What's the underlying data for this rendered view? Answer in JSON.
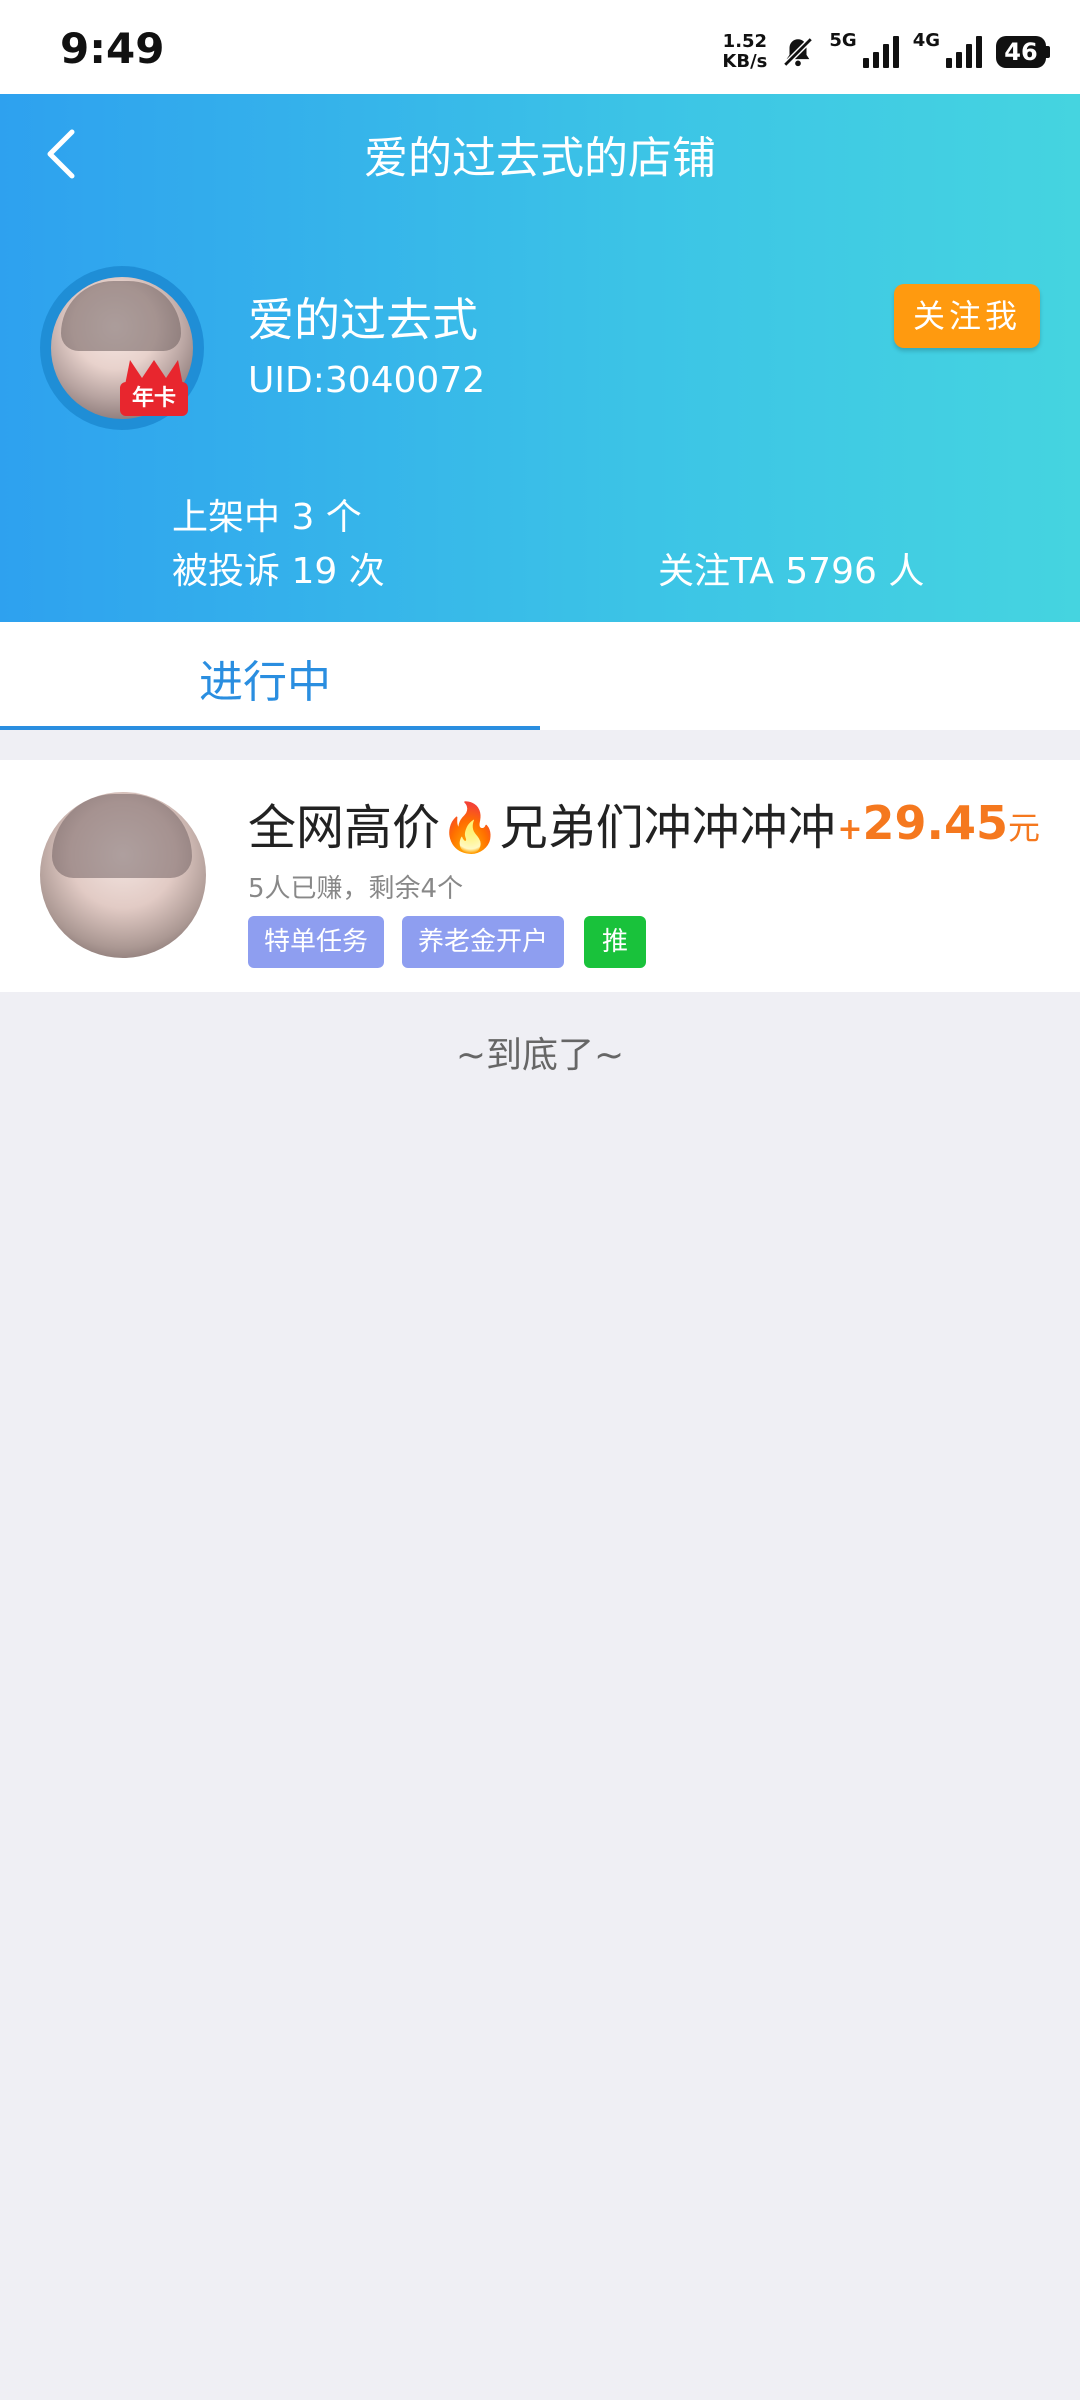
{
  "status_bar": {
    "time": "9:49",
    "net_speed_value": "1.52",
    "net_speed_unit": "KB/s",
    "signal_1": "5G",
    "signal_2": "4G",
    "battery": "46"
  },
  "header": {
    "title": "爱的过去式的店铺",
    "shop_name": "爱的过去式",
    "uid": "UID:3040072",
    "vip_badge": "年卡",
    "follow_label": "关注我",
    "stat_listed": "上架中 3 个",
    "stat_complaints": "被投诉 19 次",
    "stat_followers": "关注TA 5796 人"
  },
  "tabs": [
    {
      "label": "进行中",
      "active": true
    }
  ],
  "tasks": [
    {
      "title": "全网高价🔥兄弟们冲冲冲冲",
      "subtitle": "5人已赚，剩余4个",
      "tags": [
        "特单任务",
        "养老金开户",
        "推"
      ],
      "price_prefix": "+",
      "price": "29.45",
      "price_unit": "元"
    }
  ],
  "end_text": "~到底了~",
  "colors": {
    "header_gradient_start": "#2ea1ef",
    "header_gradient_end": "#45d4e0",
    "follow_button": "#ff9a0f",
    "tab_active": "#2a8ee0",
    "price": "#f5781e",
    "tag_purple": "#8e9ef0",
    "tag_green": "#19c23b"
  },
  "icons": {
    "back": "chevron-left-icon",
    "mute": "bell-off-icon",
    "vip": "crown-icon"
  }
}
